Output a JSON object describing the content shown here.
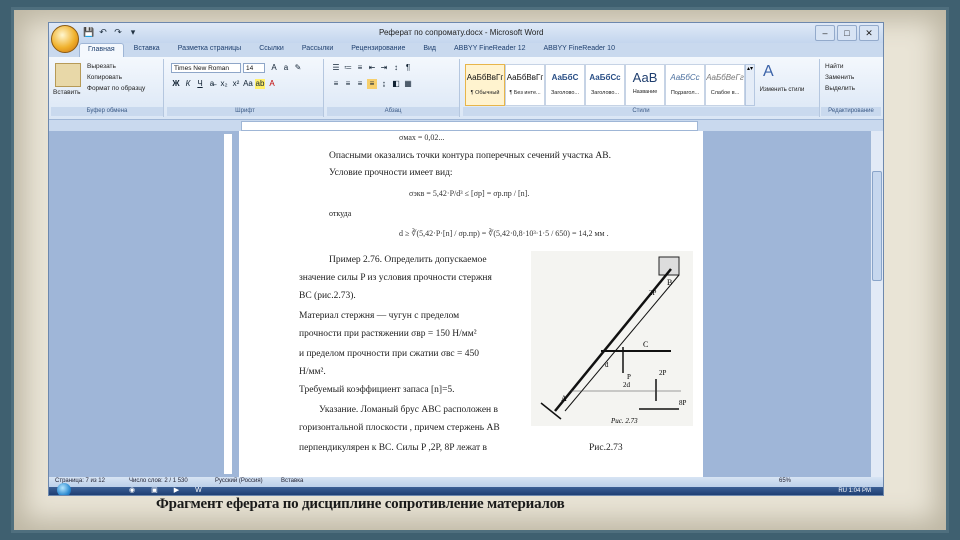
{
  "window": {
    "title": "Реферат по сопромату.docx - Microsoft Word",
    "controls": [
      "–",
      "□",
      "✕"
    ],
    "quick_access": [
      "💾",
      "↶",
      "↷",
      "▾"
    ]
  },
  "tabs": [
    "Главная",
    "Вставка",
    "Разметка страницы",
    "Ссылки",
    "Рассылки",
    "Рецензирование",
    "Вид",
    "ABBYY FineReader 12",
    "ABBYY FineReader 10"
  ],
  "ribbon": {
    "clipboard": {
      "paste": "Вставить",
      "cut": "Вырезать",
      "copy": "Копировать",
      "format_painter": "Формат по образцу",
      "label": "Буфер обмена"
    },
    "font": {
      "name": "Times New Roman",
      "size": "14",
      "label": "Шрифт"
    },
    "paragraph": {
      "label": "Абзац"
    },
    "styles": {
      "items": [
        {
          "sample": "АаБбВвГг",
          "name": "¶ Обычный"
        },
        {
          "sample": "АаБбВвГг",
          "name": "¶ Без инте..."
        },
        {
          "sample": "АаБбС",
          "name": "Заголово..."
        },
        {
          "sample": "АаБбСс",
          "name": "Заголово..."
        },
        {
          "sample": "АаВ",
          "name": "Название"
        },
        {
          "sample": "АаБбСс",
          "name": "Подзагол..."
        },
        {
          "sample": "АаБбВеГг",
          "name": "Слабое в..."
        }
      ],
      "change": "Изменить стили",
      "label": "Стили"
    },
    "editing": {
      "find": "Найти",
      "replace": "Заменить",
      "select": "Выделить",
      "label": "Редактирование"
    }
  },
  "document": {
    "lines": [
      "σмах = 0,02...",
      "Опасными оказались точки контура поперечных сечений участка AB.",
      "Условие прочности имеет вид:",
      "σэкв = 5,42·P/d³ ≤ [σp] = σр.пр / [n].",
      "откуда",
      "d ≥ ∛(5,42·P·[n] / σр.пр) = ∛(5,42·0,8·10³·1·5 / 650) = 14,2 мм .",
      "Пример 2.76. Определить допускаемое",
      "значение силы P из условия прочности стержня",
      "BC (рис.2.73).",
      "Материал стержня — чугун с пределом",
      "прочности при растяжении σвр = 150 Н/мм²",
      "и пределом прочности при сжатии σвс = 450",
      "Н/мм².",
      "Требуемый коэффициент запаса [n]=5.",
      "Указание. Ломаный брус ABC расположен в",
      "горизонтальной плоскости , причем стержень AB",
      "перпендикулярен к BC. Силы P ,2P, 8P лежат в"
    ],
    "figure_caption": "Рис.2.73",
    "figure_labels": [
      "B",
      "A",
      "C",
      "8P",
      "P",
      "2P",
      "2P",
      "d",
      "2d",
      "Рис. 2.73"
    ]
  },
  "status": {
    "page": "Страница: 7 из 12",
    "words": "Число слов: 2 / 1 530",
    "language": "Русский (Россия)",
    "insert": "Вставка",
    "zoom": "65%"
  },
  "taskbar": {
    "clock": "RU 1:04 PM"
  },
  "caption": "Фрагмент еферата по дисциплине сопротивление материалов"
}
